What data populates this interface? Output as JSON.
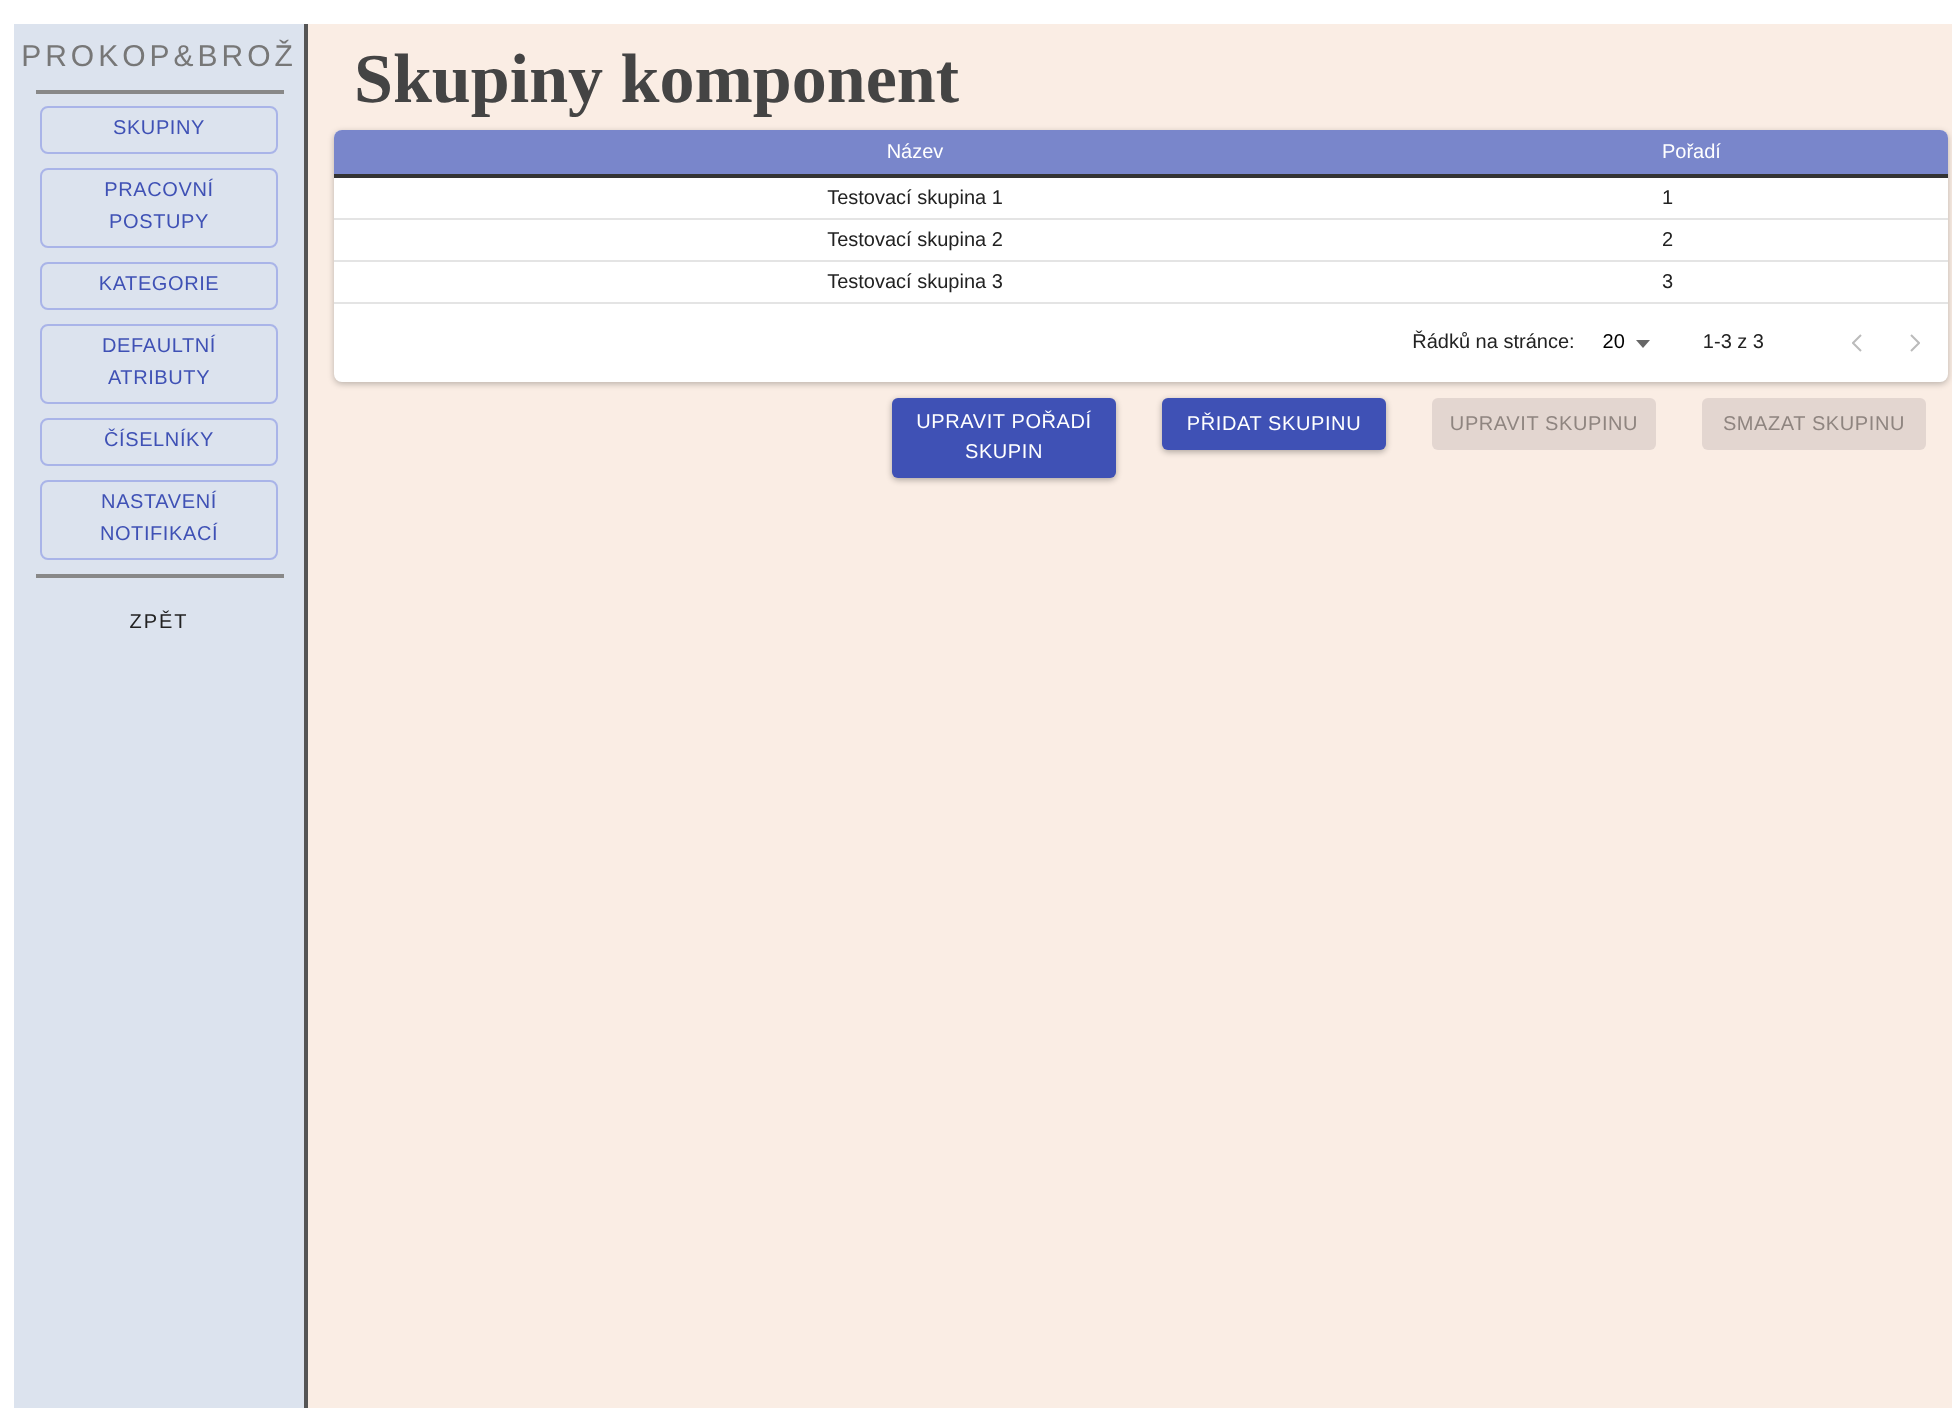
{
  "sidebar": {
    "logo": "PROKOP&BROŽ",
    "items": [
      {
        "label": "SKUPINY"
      },
      {
        "label": "PRACOVNÍ POSTUPY"
      },
      {
        "label": "KATEGORIE"
      },
      {
        "label": "DEFAULTNÍ ATRIBUTY"
      },
      {
        "label": "ČÍSELNÍKY"
      },
      {
        "label": "NASTAVENÍ NOTIFIKACÍ"
      }
    ],
    "back": "ZPĚT"
  },
  "page_title": "Skupiny komponent",
  "table": {
    "columns": [
      "Název",
      "Pořadí"
    ],
    "rows": [
      [
        "Testovací skupina 1",
        "1"
      ],
      [
        "Testovací skupina 2",
        "2"
      ],
      [
        "Testovací skupina 3",
        "3"
      ]
    ],
    "pagination": {
      "rows_per_page_label": "Řádků na stránce:",
      "rows_per_page": "20",
      "range": "1-3 z 3",
      "prev_disabled": true,
      "next_disabled": true
    }
  },
  "buttons": [
    {
      "label": "UPRAVIT POŘADÍ SKUPIN",
      "disabled": false
    },
    {
      "label": "PŘIDAT SKUPINU",
      "disabled": false
    },
    {
      "label": "UPRAVIT SKUPINU",
      "disabled": true
    },
    {
      "label": "SMAZAT SKUPINU",
      "disabled": true
    }
  ]
}
